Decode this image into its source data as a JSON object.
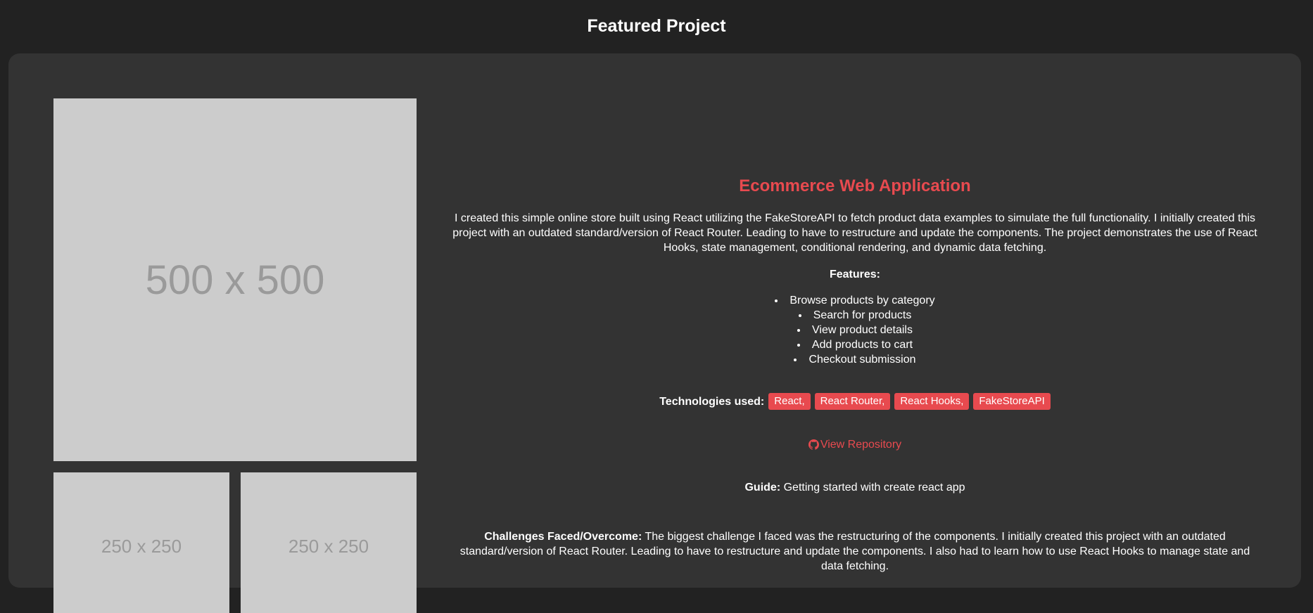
{
  "header": {
    "title": "Featured Project"
  },
  "gallery": {
    "main_label": "500 x 500",
    "thumbs": [
      {
        "label": "250 x 250"
      },
      {
        "label": "250 x 250"
      }
    ]
  },
  "project": {
    "title": "Ecommerce Web Application",
    "description": "I created this simple online store built using React utilizing the FakeStoreAPI to fetch product data examples to simulate the full functionality. I initially created this project with an outdated standard/version of React Router. Leading to have to restructure and update the components. The project demonstrates the use of React Hooks, state management, conditional rendering, and dynamic data fetching.",
    "features_label": "Features:",
    "features": [
      "Browse products by category",
      "Search for products",
      "View product details",
      "Add products to cart",
      "Checkout submission"
    ],
    "technologies_label": "Technologies used:",
    "technologies": [
      "React,",
      "React Router,",
      "React Hooks,",
      "FakeStoreAPI"
    ],
    "repo_link": "View Repository",
    "guide_label": "Guide:",
    "guide_text": " Getting started with create react app",
    "challenges_label": "Challenges Faced/Overcome:",
    "challenges_text": " The biggest challenge I faced was the restructuring of the components. I initially created this project with an outdated standard/version of React Router. Leading to have to restructure and update the components. I also had to learn how to use React Hooks to manage state and data fetching."
  },
  "colors": {
    "accent": "#e84a4f",
    "page_bg": "#222222",
    "card_bg": "#333333",
    "placeholder_bg": "#cccccc"
  },
  "icons": {
    "repo": "github-icon"
  }
}
